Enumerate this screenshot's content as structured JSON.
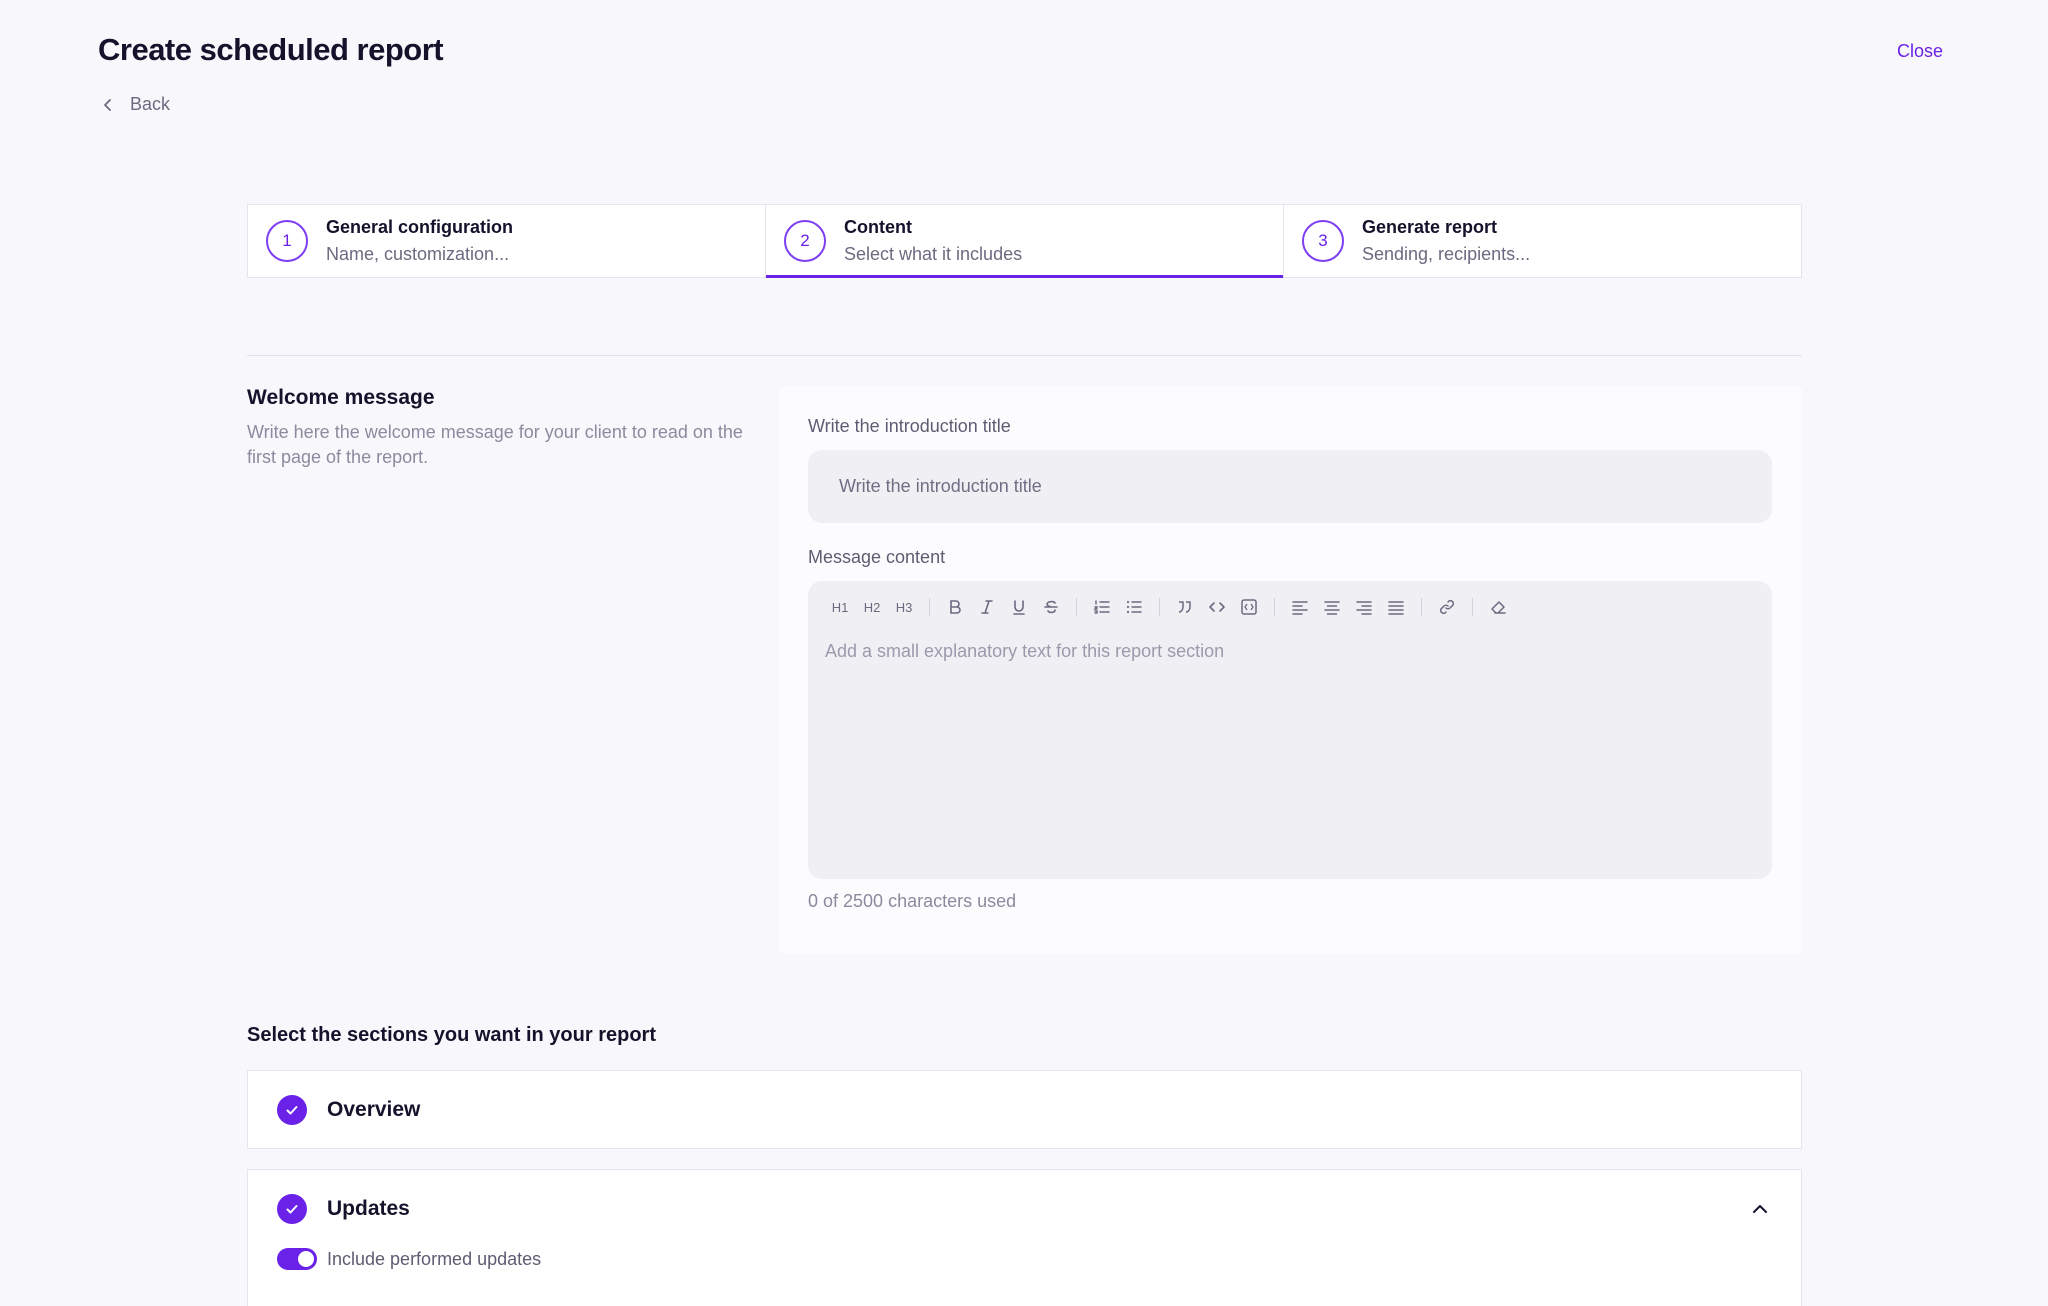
{
  "header": {
    "title": "Create scheduled report",
    "close_label": "Close",
    "back_label": "Back"
  },
  "stepper": {
    "steps": [
      {
        "number": "1",
        "title": "General configuration",
        "subtitle": "Name, customization..."
      },
      {
        "number": "2",
        "title": "Content",
        "subtitle": "Select what it includes"
      },
      {
        "number": "3",
        "title": "Generate report",
        "subtitle": "Sending, recipients..."
      }
    ],
    "active_step": 2
  },
  "welcome": {
    "title": "Welcome message",
    "description": "Write here the welcome message for your client to read on the first page of the report.",
    "intro_label": "Write the introduction title",
    "intro_placeholder": "Write the introduction title",
    "content_label": "Message content",
    "content_placeholder": "Add a small explanatory text for this report section",
    "char_count": "0 of 2500 characters used",
    "toolbar": {
      "h1": "H1",
      "h2": "H2",
      "h3": "H3"
    }
  },
  "sections": {
    "title": "Select the sections you want in your report",
    "items": [
      {
        "name": "Overview",
        "checked": true
      },
      {
        "name": "Updates",
        "checked": true,
        "expanded": true,
        "toggle_label": "Include performed updates",
        "toggle_on": true
      }
    ]
  },
  "colors": {
    "accent": "#6a22e8",
    "background": "#f8f8fc",
    "input_bg": "#f0f0f4"
  }
}
